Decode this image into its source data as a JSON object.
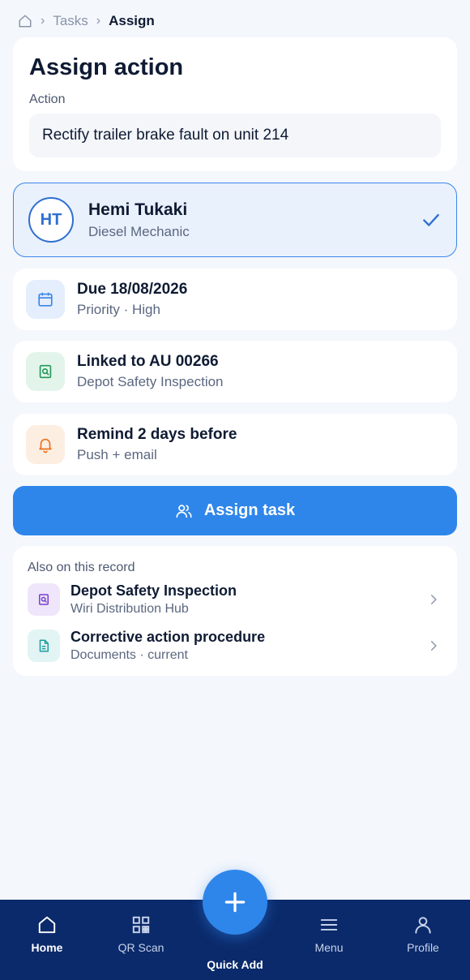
{
  "breadcrumb": {
    "parent": "Tasks",
    "current": "Assign"
  },
  "action_card": {
    "title": "Assign action",
    "field_label": "Action",
    "field_value": "Rectify trailer brake fault on unit 214"
  },
  "assignee": {
    "initials": "HT",
    "name": "Hemi Tukaki",
    "role": "Diesel Mechanic"
  },
  "due": {
    "title": "Due 18/08/2026",
    "subtitle": "Priority · High"
  },
  "linked": {
    "title": "Linked to AU 00266",
    "subtitle": "Depot Safety Inspection"
  },
  "reminder": {
    "title": "Remind 2 days before",
    "subtitle": "Push + email"
  },
  "assign_button": {
    "label": "Assign task"
  },
  "record": {
    "heading": "Also on this record",
    "items": [
      {
        "title": "Depot Safety Inspection",
        "subtitle": "Wiri Distribution Hub",
        "icon": "inspection-icon"
      },
      {
        "title": "Corrective action procedure",
        "subtitle": "Documents · current",
        "icon": "document-icon"
      }
    ]
  },
  "nav": {
    "home": "Home",
    "qr": "QR Scan",
    "quick_add": "Quick Add",
    "menu": "Menu",
    "profile": "Profile"
  },
  "colors": {
    "accent": "#2f86ea",
    "nav_background": "#0b2a6b",
    "page_background": "#f4f7fc",
    "selected_card": "#e9f1fd"
  }
}
